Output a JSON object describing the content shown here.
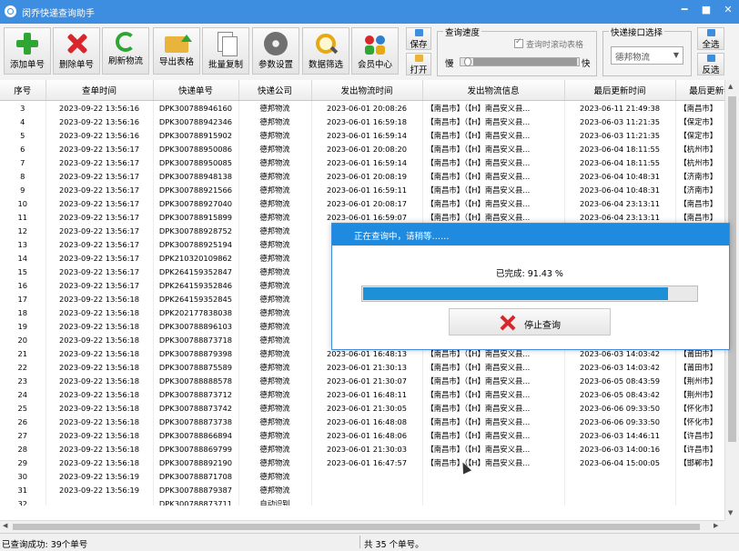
{
  "window": {
    "title": "闵乔快递查询助手",
    "controls": [
      "━",
      "■",
      "✕"
    ]
  },
  "toolbar": {
    "buttons": [
      {
        "label": "添加单号",
        "icon": "add-plus-icon"
      },
      {
        "label": "删除单号",
        "icon": "delete-x-icon"
      },
      {
        "label": "刷新物流",
        "icon": "refresh-icon"
      },
      {
        "label": "导出表格",
        "icon": "export-folder-icon"
      },
      {
        "label": "批量复制",
        "icon": "copy-icon"
      },
      {
        "label": "参数设置",
        "icon": "gear-icon"
      },
      {
        "label": "数据筛选",
        "icon": "search-icon"
      },
      {
        "label": "会员中心",
        "icon": "users-icon"
      }
    ],
    "save_label": "保存",
    "open_label": "打开",
    "speed": {
      "title": "查询速度",
      "auto_scroll_label": "查询时滚动表格",
      "slow": "慢",
      "fast": "快",
      "level": 0.02
    },
    "interface": {
      "title": "快递接口选择",
      "selected": "德邦物流"
    },
    "select_all_label": "全选",
    "invert_label": "反选"
  },
  "table": {
    "columns": [
      "序号",
      "查单时间",
      "快递单号",
      "快递公司",
      "发出物流时间",
      "发出物流信息",
      "最后更新时间",
      "最后更新物"
    ],
    "rows": [
      [
        "3",
        "2023-09-22 13:56:16",
        "DPK300788946160",
        "德邦物流",
        "2023-06-01 20:08:26",
        "【南昌市】（【H】南昌安义县...",
        "2023-06-11 21:49:38",
        "【南昌市】"
      ],
      [
        "4",
        "2023-09-22 13:56:16",
        "DPK300788942346",
        "德邦物流",
        "2023-06-01 16:59:18",
        "【南昌市】（【H】南昌安义县...",
        "2023-06-03 11:21:35",
        "【保定市】"
      ],
      [
        "5",
        "2023-09-22 13:56:16",
        "DPK300788915902",
        "德邦物流",
        "2023-06-01 16:59:14",
        "【南昌市】（【H】南昌安义县...",
        "2023-06-03 11:21:35",
        "【保定市】"
      ],
      [
        "6",
        "2023-09-22 13:56:17",
        "DPK300788950086",
        "德邦物流",
        "2023-06-01 20:08:20",
        "【南昌市】（【H】南昌安义县...",
        "2023-06-04 18:11:55",
        "【杭州市】"
      ],
      [
        "7",
        "2023-09-22 13:56:17",
        "DPK300788950085",
        "德邦物流",
        "2023-06-01 16:59:14",
        "【南昌市】（【H】南昌安义县...",
        "2023-06-04 18:11:55",
        "【杭州市】"
      ],
      [
        "8",
        "2023-09-22 13:56:17",
        "DPK300788948138",
        "德邦物流",
        "2023-06-01 20:08:19",
        "【南昌市】（【H】南昌安义县...",
        "2023-06-04 10:48:31",
        "【济南市】"
      ],
      [
        "9",
        "2023-09-22 13:56:17",
        "DPK300788921566",
        "德邦物流",
        "2023-06-01 16:59:11",
        "【南昌市】（【H】南昌安义县...",
        "2023-06-04 10:48:31",
        "【济南市】"
      ],
      [
        "10",
        "2023-09-22 13:56:17",
        "DPK300788927040",
        "德邦物流",
        "2023-06-01 20:08:17",
        "【南昌市】（【H】南昌安义县...",
        "2023-06-04 23:13:11",
        "【南昌市】"
      ],
      [
        "11",
        "2023-09-22 13:56:17",
        "DPK300788915899",
        "德邦物流",
        "2023-06-01 16:59:07",
        "【南昌市】（【H】南昌安义县...",
        "2023-06-04 23:13:11",
        "【南昌市】"
      ],
      [
        "12",
        "2023-09-22 13:56:17",
        "DPK300788928752",
        "德邦物流",
        "20",
        "",
        "",
        ""
      ],
      [
        "13",
        "2023-09-22 13:56:17",
        "DPK300788925194",
        "德邦物流",
        "20",
        "",
        "",
        ""
      ],
      [
        "14",
        "2023-09-22 13:56:17",
        "DPK210320109862",
        "德邦物流",
        "20",
        "",
        "",
        ""
      ],
      [
        "15",
        "2023-09-22 13:56:17",
        "DPK264159352847",
        "德邦物流",
        "20",
        "",
        "",
        ""
      ],
      [
        "16",
        "2023-09-22 13:56:17",
        "DPK264159352846",
        "德邦物流",
        "20",
        "",
        "",
        ""
      ],
      [
        "17",
        "2023-09-22 13:56:18",
        "DPK264159352845",
        "德邦物流",
        "20",
        "",
        "",
        ""
      ],
      [
        "18",
        "2023-09-22 13:56:18",
        "DPK202177838038",
        "德邦物流",
        "20",
        "",
        "",
        ""
      ],
      [
        "19",
        "2023-09-22 13:56:18",
        "DPK300788896103",
        "德邦物流",
        "20",
        "",
        "",
        ""
      ],
      [
        "20",
        "2023-09-22 13:56:18",
        "DPK300788873718",
        "德邦物流",
        "20",
        "",
        "",
        ""
      ],
      [
        "21",
        "2023-09-22 13:56:18",
        "DPK300788879398",
        "德邦物流",
        "2023-06-01 16:48:13",
        "【南昌市】（【H】南昌安义县...",
        "2023-06-03 14:03:42",
        "【莆田市】"
      ],
      [
        "22",
        "2023-09-22 13:56:18",
        "DPK300788875589",
        "德邦物流",
        "2023-06-01 21:30:13",
        "【南昌市】（【H】南昌安义县...",
        "2023-06-03 14:03:42",
        "【莆田市】"
      ],
      [
        "23",
        "2023-09-22 13:56:18",
        "DPK300788888578",
        "德邦物流",
        "2023-06-01 21:30:07",
        "【南昌市】（【H】南昌安义县...",
        "2023-06-05 08:43:59",
        "【荆州市】"
      ],
      [
        "24",
        "2023-09-22 13:56:18",
        "DPK300788873712",
        "德邦物流",
        "2023-06-01 16:48:11",
        "【南昌市】（【H】南昌安义县...",
        "2023-06-05 08:43:42",
        "【荆州市】"
      ],
      [
        "25",
        "2023-09-22 13:56:18",
        "DPK300788873742",
        "德邦物流",
        "2023-06-01 21:30:05",
        "【南昌市】（【H】南昌安义县...",
        "2023-06-06 09:33:50",
        "【怀化市】"
      ],
      [
        "26",
        "2023-09-22 13:56:18",
        "DPK300788873738",
        "德邦物流",
        "2023-06-01 16:48:08",
        "【南昌市】（【H】南昌安义县...",
        "2023-06-06 09:33:50",
        "【怀化市】"
      ],
      [
        "27",
        "2023-09-22 13:56:18",
        "DPK300788866894",
        "德邦物流",
        "2023-06-01 16:48:06",
        "【南昌市】（【H】南昌安义县...",
        "2023-06-03 14:46:11",
        "【许昌市】"
      ],
      [
        "28",
        "2023-09-22 13:56:18",
        "DPK300788869799",
        "德邦物流",
        "2023-06-01 21:30:03",
        "【南昌市】（【H】南昌安义县...",
        "2023-06-03 14:00:16",
        "【许昌市】"
      ],
      [
        "29",
        "2023-09-22 13:56:18",
        "DPK300788892190",
        "德邦物流",
        "2023-06-01 16:47:57",
        "【南昌市】（【H】南昌安义县...",
        "2023-06-04 15:00:05",
        "【邯郸市】"
      ],
      [
        "30",
        "2023-09-22 13:56:19",
        "DPK300788871708",
        "德邦物流",
        "",
        "",
        "",
        ""
      ],
      [
        "31",
        "2023-09-22 13:56:19",
        "DPK300788879387",
        "德邦物流",
        "",
        "",
        "",
        ""
      ],
      [
        "32",
        "",
        "DPK300788873711",
        "自动识别",
        "",
        "",
        "",
        ""
      ]
    ]
  },
  "dialog": {
    "title": "正在查询中，请稍等……",
    "progress_text": "已完成: 91.43 %",
    "progress": 0.9143,
    "stop_label": "停止查询"
  },
  "status": {
    "left": "已查询成功: 39个单号",
    "middle": "共 35 个单号。"
  }
}
